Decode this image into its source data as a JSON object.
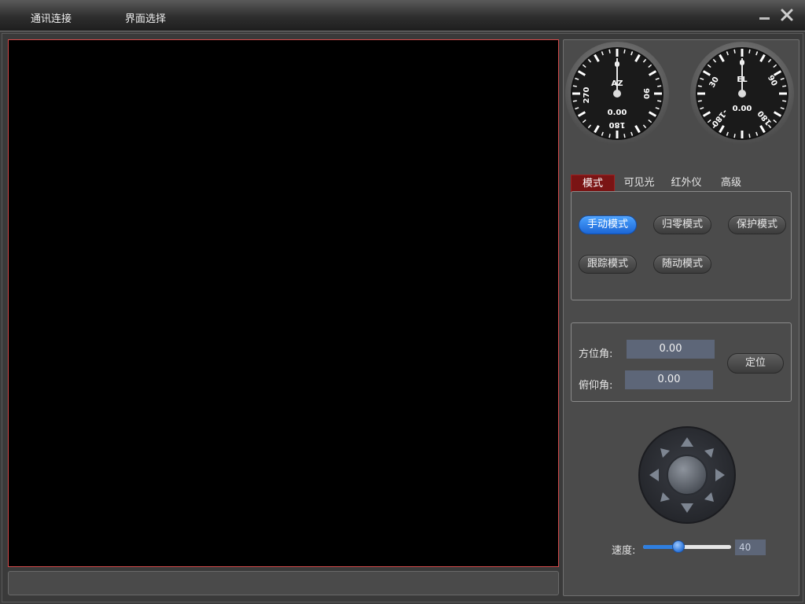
{
  "menu": {
    "items": [
      "通讯连接",
      "界面选择"
    ]
  },
  "window": {
    "minimize_icon": "minimize-icon",
    "close_icon": "close-icon"
  },
  "gauges": {
    "az": {
      "name": "AZ",
      "value": "0.00",
      "labels": [
        "0",
        "90",
        "180",
        "270"
      ]
    },
    "el": {
      "name": "EL",
      "value": "0.00",
      "labels": [
        "0",
        "30",
        "90",
        "180",
        "-180"
      ]
    }
  },
  "tabs": [
    "模式",
    "可见光",
    "红外仪",
    "高级"
  ],
  "modes": [
    "手动模式",
    "归零模式",
    "保护模式",
    "跟踪模式",
    "随动模式"
  ],
  "position": {
    "azimuth_label": "方位角:",
    "azimuth_value": "0.00",
    "elevation_label": "俯仰角:",
    "elevation_value": "0.00",
    "locate_button": "定位"
  },
  "speed": {
    "label": "速度:",
    "value": "40",
    "fraction": 0.4
  },
  "colors": {
    "active_tab": "#7a1414",
    "active_mode": "#2f7fe0",
    "video_border": "#d24a4a"
  }
}
